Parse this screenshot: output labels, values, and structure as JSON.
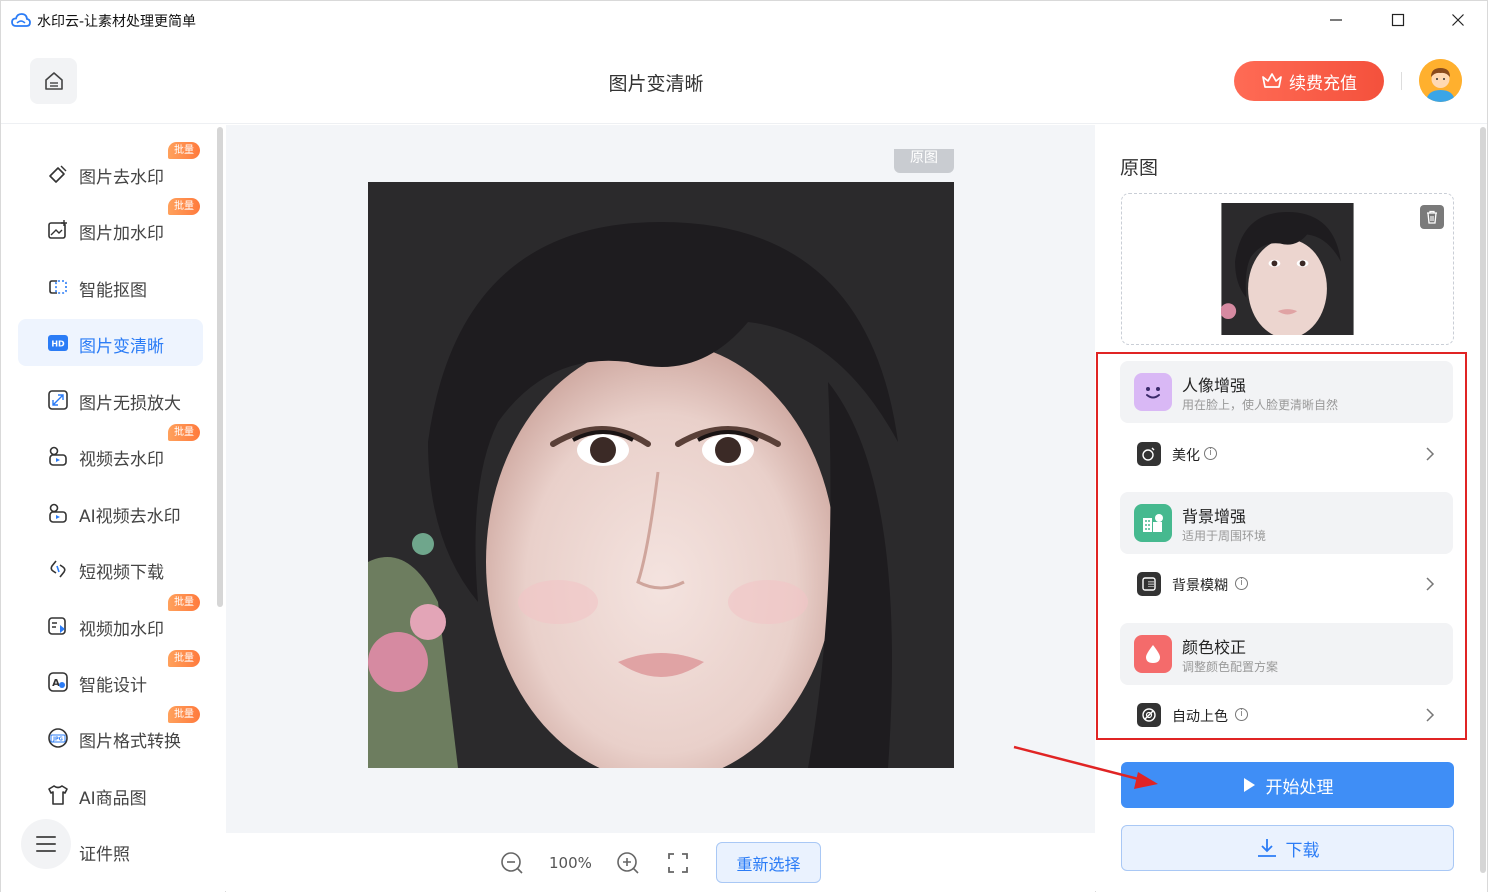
{
  "window": {
    "title": "水印云-让素材处理更简单"
  },
  "header": {
    "page_title": "图片变清晰",
    "vip_label": "续费充值"
  },
  "sidebar": {
    "items": [
      {
        "label": "图片去水印",
        "badge": "批量",
        "icon": "eraser-icon"
      },
      {
        "label": "图片加水印",
        "badge": "批量",
        "icon": "image-add-icon"
      },
      {
        "label": "智能抠图",
        "badge": "",
        "icon": "cutout-icon"
      },
      {
        "label": "图片变清晰",
        "badge": "",
        "icon": "hd-icon",
        "active": true
      },
      {
        "label": "图片无损放大",
        "badge": "",
        "icon": "enlarge-icon"
      },
      {
        "label": "视频去水印",
        "badge": "批量",
        "icon": "video-eraser-icon"
      },
      {
        "label": "AI视频去水印",
        "badge": "",
        "icon": "ai-video-icon"
      },
      {
        "label": "短视频下载",
        "badge": "",
        "icon": "link-download-icon"
      },
      {
        "label": "视频加水印",
        "badge": "批量",
        "icon": "video-add-icon"
      },
      {
        "label": "智能设计",
        "badge": "批量",
        "icon": "design-icon"
      },
      {
        "label": "图片格式转换",
        "badge": "批量",
        "icon": "jpg-format-icon"
      },
      {
        "label": "AI商品图",
        "badge": "",
        "icon": "shirt-icon"
      },
      {
        "label": "证件照",
        "badge": "",
        "icon": "id-photo-icon"
      }
    ]
  },
  "canvas": {
    "original_tag": "原图"
  },
  "zoombar": {
    "zoom_level": "100%",
    "reselect_label": "重新选择"
  },
  "panel": {
    "title": "原图",
    "groups": [
      {
        "name": "人像增强",
        "desc": "用在脸上，使人脸更清晰自然",
        "row_label": "美化",
        "info": "i"
      },
      {
        "name": "背景增强",
        "desc": "适用于周围环境",
        "row_label": "背景模糊",
        "info": "i"
      },
      {
        "name": "颜色校正",
        "desc": "调整颜色配置方案",
        "row_label": "自动上色",
        "info": "i"
      }
    ],
    "start_label": "开始处理",
    "download_label": "下载"
  },
  "colors": {
    "accent": "#3f8ef6",
    "vip": "#f4513c",
    "highlight_frame": "#e02424"
  }
}
